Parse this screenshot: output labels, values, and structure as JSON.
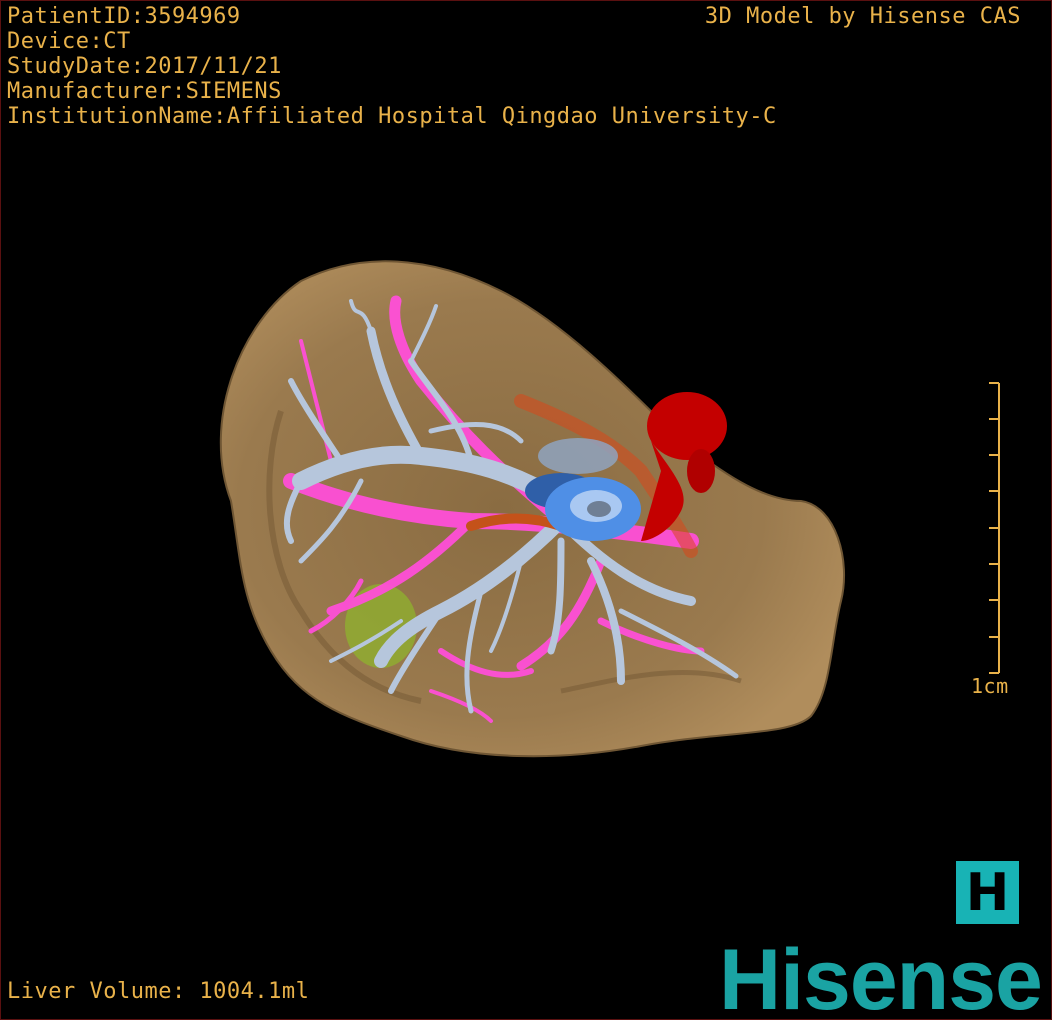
{
  "info": {
    "patient_id": "PatientID:3594969",
    "device": "Device:CT",
    "study_date": "StudyDate:2017/11/21",
    "manufacturer": "Manufacturer:SIEMENS",
    "institution": "InstitutionName:Affiliated Hospital Qingdao University-C"
  },
  "brand_caption": "3D Model by Hisense CAS",
  "measurement": {
    "liver_volume": "Liver Volume: 1004.1ml"
  },
  "scale_bar": {
    "label": "1cm"
  },
  "badge_letter": "H",
  "logo_text": "Hisense",
  "colors": {
    "overlay_text": "#e9b24a",
    "liver": "#9a7a4e",
    "portal_vein": "#b6c6dc",
    "hepatic_vein": "#ff4fd8",
    "artery": "#c40000",
    "ivc": "#4f8fe6",
    "tumor": "#8fb32e",
    "brand": "#1aa3a3"
  }
}
